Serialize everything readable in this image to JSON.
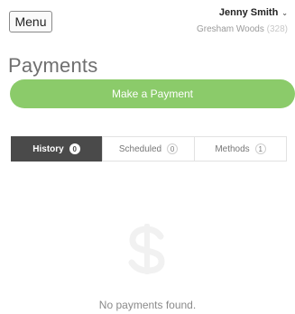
{
  "header": {
    "menu_label": "Menu",
    "user_name": "Jenny Smith",
    "community": "Gresham Woods",
    "community_code": "(328)"
  },
  "page": {
    "title": "Payments",
    "primary_action": "Make a Payment"
  },
  "tabs": [
    {
      "label": "History",
      "count": "0",
      "active": true
    },
    {
      "label": "Scheduled",
      "count": "0",
      "active": false
    },
    {
      "label": "Methods",
      "count": "1",
      "active": false
    }
  ],
  "empty_state": {
    "icon": "dollar-icon",
    "message": "No payments found."
  },
  "colors": {
    "accent_green": "#8bcb6a",
    "active_tab": "#4a4a4a"
  }
}
